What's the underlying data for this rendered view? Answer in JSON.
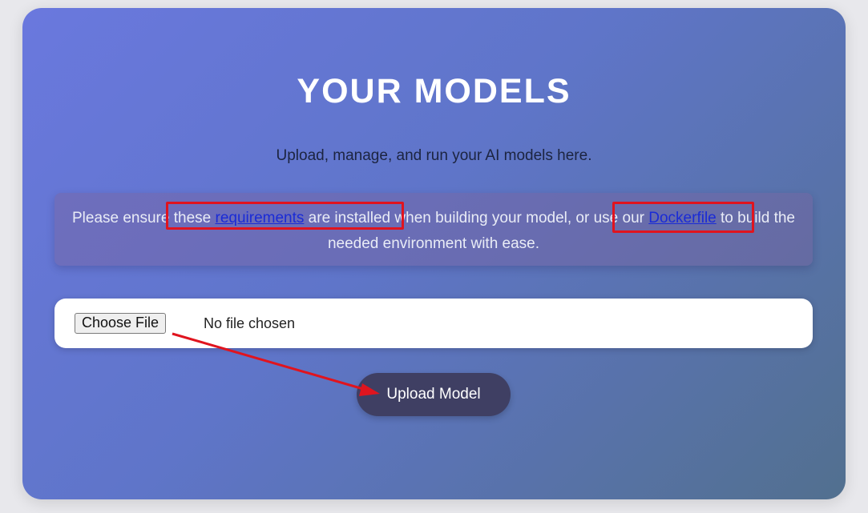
{
  "page": {
    "title": "YOUR MODELS",
    "subtitle": "Upload, manage, and run your AI models here."
  },
  "notice": {
    "part1": "Please ensure ",
    "part2": "these ",
    "requirements_link": "requirements",
    "part3": " are installed",
    "part4": " when building your model, or ",
    "part5": "use our ",
    "dockerfile_link": "Dockerfile",
    "part6": " to build the needed environment with ease."
  },
  "upload": {
    "choose_file_label": "Choose File",
    "file_status": "No file chosen",
    "upload_button_label": "Upload Model"
  },
  "colors": {
    "card_gradient_start": "#6a78de",
    "card_gradient_end": "#52708f",
    "link": "#1a2bd6",
    "annotation": "#e0141e",
    "upload_button": "#3f3f63"
  }
}
